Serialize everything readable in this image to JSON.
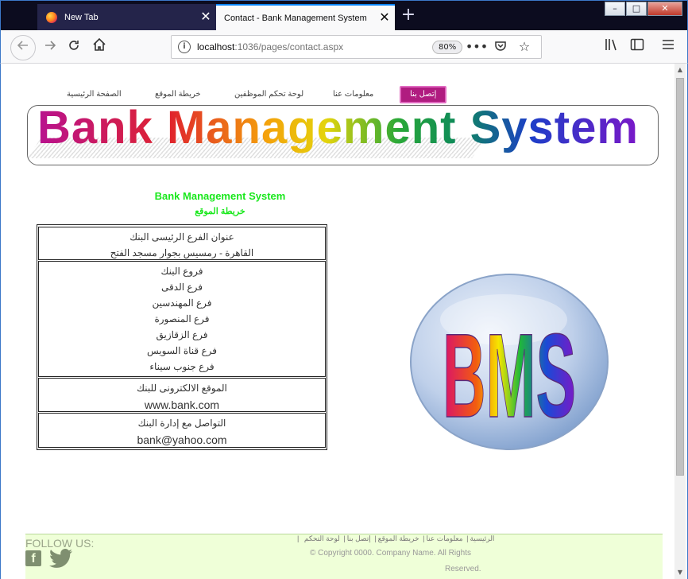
{
  "browser": {
    "tabs": [
      {
        "label": "New Tab"
      },
      {
        "label": "Contact - Bank Management System"
      }
    ],
    "new_tab_symbol": "+",
    "close_symbol": "✕",
    "url_host": "localhost",
    "url_rest": ":1036/pages/contact.aspx",
    "zoom": "80%",
    "window_controls": {
      "minimize": "–",
      "maximize": "□",
      "close": "✕"
    }
  },
  "site_nav": {
    "home": "الصفحة الرئيسية",
    "sitemap": "خريطة الموقع",
    "employees": "لوحة تحكم الموظفين",
    "about": "معلومات عنا",
    "contact": "إتصل بنا"
  },
  "banner": {
    "title": "Bank Management System"
  },
  "content": {
    "title": "Bank Management System",
    "subtitle": "خريطة الموقع",
    "main_branch_label": "عنوان الفرع الرئيسى البنك",
    "main_branch_address": "القاهرة - رمسيس بجوار مسجد الفتح",
    "branches_label": "فروع البنك",
    "branches": [
      "فرع الدقى",
      "فرع المهندسين",
      "فرع المنصورة",
      "فرع الزقازيق",
      "فرع قناة السويس",
      "فرع جنوب سيناء"
    ],
    "website_label": "الموقع الالكترونى للبنك",
    "website": "www.bank.com",
    "contact_label": "التواصل مع إدارة البنك",
    "email": "bank@yahoo.com"
  },
  "logo": {
    "text": "BMS"
  },
  "footer": {
    "follow_label": "FOLLOW US:",
    "facebook_letter": "f",
    "links": [
      "لوحة التحكم",
      "إتصل بنا",
      "خريطة الموقع",
      "معلومات عنا",
      "الرئيسية"
    ],
    "copyright_line1": "© Copyright 0000. Company Name. All Rights",
    "copyright_line2": "Reserved."
  }
}
